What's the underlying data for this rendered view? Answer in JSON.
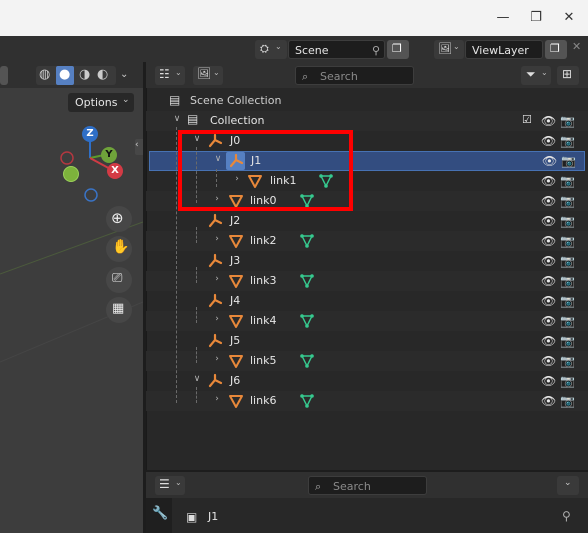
{
  "window": {
    "minimize": "—",
    "restore": "❐",
    "close": "✕"
  },
  "topbar": {
    "scene_label": "Scene",
    "viewlayer_label": "ViewLayer"
  },
  "viewport": {
    "options_label": "Options",
    "gizmo": {
      "z": "Z",
      "y": "Y",
      "x": "X"
    }
  },
  "outliner": {
    "search_placeholder": "Search",
    "items": [
      {
        "label": "Scene Collection"
      },
      {
        "label": "Collection"
      },
      {
        "label": "J0"
      },
      {
        "label": "J1"
      },
      {
        "label": "link1"
      },
      {
        "label": "link0"
      },
      {
        "label": "J2"
      },
      {
        "label": "link2"
      },
      {
        "label": "J3"
      },
      {
        "label": "link3"
      },
      {
        "label": "J4"
      },
      {
        "label": "link4"
      },
      {
        "label": "J5"
      },
      {
        "label": "link5"
      },
      {
        "label": "J6"
      },
      {
        "label": "link6"
      }
    ]
  },
  "properties": {
    "search_placeholder": "Search",
    "object_name": "J1"
  },
  "colors": {
    "armature": "#e8883a",
    "mesh": "#e8883a",
    "vertex_group": "#36c98f",
    "selected": "#334d80",
    "highlight_box": "#ff0000"
  }
}
